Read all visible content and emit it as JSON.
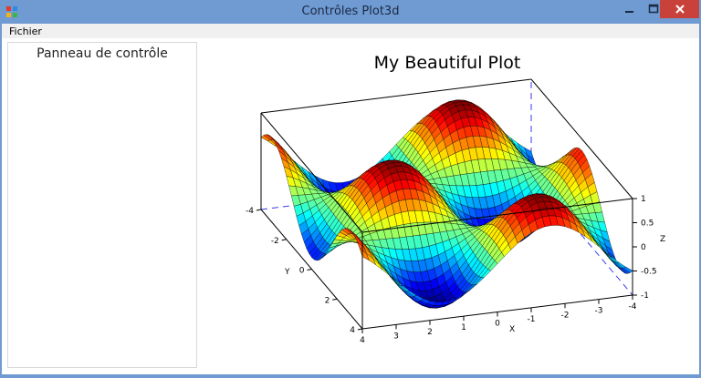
{
  "window": {
    "title": "Contrôles Plot3d",
    "close_icon": "close-icon",
    "minimize_icon": "minimize-icon",
    "maximize_icon": "maximize-icon"
  },
  "menu": {
    "file_label": "Fichier"
  },
  "panel": {
    "title": "Panneau de contrôle"
  },
  "plot": {
    "title": "My Beautiful Plot",
    "xlabel": "X",
    "ylabel": "Y",
    "zlabel": "Z"
  },
  "chart_data": {
    "type": "surface",
    "title": "My Beautiful Plot",
    "xlabel": "X",
    "ylabel": "Y",
    "zlabel": "Z",
    "xlim": [
      -4,
      4
    ],
    "ylim": [
      -4,
      4
    ],
    "zlim": [
      -1,
      1
    ],
    "x_ticks": [
      "4",
      "3",
      "2",
      "1",
      "0",
      "-1",
      "-2",
      "-3",
      "-4"
    ],
    "y_ticks": [
      "-4",
      "-2",
      "0",
      "2",
      "4"
    ],
    "z_ticks": [
      "1",
      "0.5",
      "0",
      "-0.5",
      "-1"
    ],
    "grid_n": 40,
    "colormap": "jet",
    "colors": {
      "mesh": "#000000",
      "box": "#000000",
      "hidden_box": "#3a3aee"
    }
  }
}
